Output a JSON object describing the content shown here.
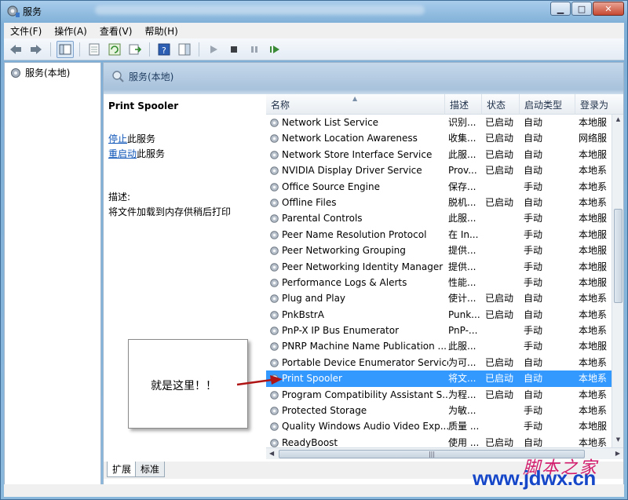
{
  "window": {
    "title": "服务"
  },
  "menu": [
    {
      "label": "文件(F)"
    },
    {
      "label": "操作(A)"
    },
    {
      "label": "查看(V)"
    },
    {
      "label": "帮助(H)"
    }
  ],
  "tree": {
    "root_label": "服务(本地)"
  },
  "pane": {
    "header_label": "服务(本地)"
  },
  "detail": {
    "service_name": "Print Spooler",
    "stop_link": "停止",
    "stop_suffix": "此服务",
    "restart_link": "重启动",
    "restart_suffix": "此服务",
    "desc_label": "描述:",
    "desc_text": "将文件加载到内存供稍后打印"
  },
  "columns": {
    "name": "名称",
    "desc": "描述",
    "status": "状态",
    "start": "启动类型",
    "logon": "登录为"
  },
  "rows": [
    {
      "name": "Network List Service",
      "desc": "识别...",
      "status": "已启动",
      "start": "自动",
      "logon": "本地服"
    },
    {
      "name": "Network Location Awareness",
      "desc": "收集...",
      "status": "已启动",
      "start": "自动",
      "logon": "网络服"
    },
    {
      "name": "Network Store Interface Service",
      "desc": "此服...",
      "status": "已启动",
      "start": "自动",
      "logon": "本地服"
    },
    {
      "name": "NVIDIA Display Driver Service",
      "desc": "Prov...",
      "status": "已启动",
      "start": "自动",
      "logon": "本地系"
    },
    {
      "name": "Office Source Engine",
      "desc": "保存...",
      "status": "",
      "start": "手动",
      "logon": "本地系"
    },
    {
      "name": "Offline Files",
      "desc": "脱机...",
      "status": "已启动",
      "start": "自动",
      "logon": "本地系"
    },
    {
      "name": "Parental Controls",
      "desc": "此服...",
      "status": "",
      "start": "手动",
      "logon": "本地服"
    },
    {
      "name": "Peer Name Resolution Protocol",
      "desc": "在 In...",
      "status": "",
      "start": "手动",
      "logon": "本地服"
    },
    {
      "name": "Peer Networking Grouping",
      "desc": "提供...",
      "status": "",
      "start": "手动",
      "logon": "本地服"
    },
    {
      "name": "Peer Networking Identity Manager",
      "desc": "提供...",
      "status": "",
      "start": "手动",
      "logon": "本地服"
    },
    {
      "name": "Performance Logs & Alerts",
      "desc": "性能...",
      "status": "",
      "start": "手动",
      "logon": "本地服"
    },
    {
      "name": "Plug and Play",
      "desc": "使计...",
      "status": "已启动",
      "start": "自动",
      "logon": "本地系"
    },
    {
      "name": "PnkBstrA",
      "desc": "Punk...",
      "status": "已启动",
      "start": "自动",
      "logon": "本地系"
    },
    {
      "name": "PnP-X IP Bus Enumerator",
      "desc": "PnP-...",
      "status": "",
      "start": "手动",
      "logon": "本地系"
    },
    {
      "name": "PNRP Machine Name Publication ...",
      "desc": "此服...",
      "status": "",
      "start": "手动",
      "logon": "本地服"
    },
    {
      "name": "Portable Device Enumerator Service",
      "desc": "为可...",
      "status": "已启动",
      "start": "自动",
      "logon": "本地系"
    },
    {
      "name": "Print Spooler",
      "desc": "将文...",
      "status": "已启动",
      "start": "自动",
      "logon": "本地系",
      "selected": true
    },
    {
      "name": "Program Compatibility Assistant S...",
      "desc": "为程...",
      "status": "已启动",
      "start": "自动",
      "logon": "本地系"
    },
    {
      "name": "Protected Storage",
      "desc": "为敏...",
      "status": "",
      "start": "手动",
      "logon": "本地系"
    },
    {
      "name": "Quality Windows Audio Video Exp...",
      "desc": "质量 ...",
      "status": "",
      "start": "手动",
      "logon": "本地服"
    },
    {
      "name": "ReadyBoost",
      "desc": "使用 ...",
      "status": "已启动",
      "start": "自动",
      "logon": "本地系"
    }
  ],
  "tabs": [
    {
      "label": "扩展"
    },
    {
      "label": "标准"
    }
  ],
  "callout": {
    "text": "就是这里！！"
  },
  "watermark": {
    "cn": "脚本之家",
    "url": "www.jdwx.cn"
  },
  "colors": {
    "selection": "#3399ff",
    "link": "#0f56b8",
    "arrow": "#b01515"
  }
}
